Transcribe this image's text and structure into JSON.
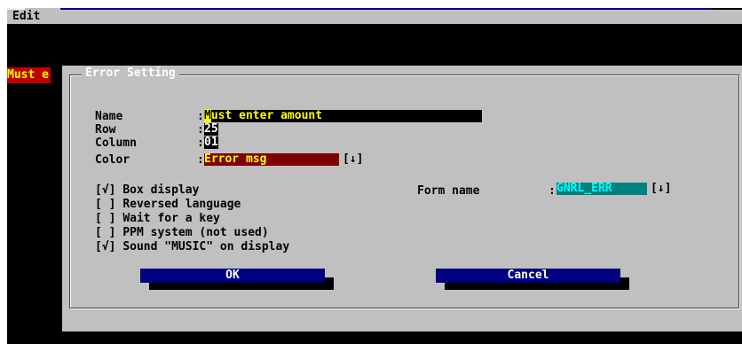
{
  "menu": {
    "edit": "Edit"
  },
  "background_message": "Must e",
  "dialog": {
    "title": "Error Setting",
    "fields": {
      "name_label": "Name",
      "name_first": "M",
      "name_rest": "ust enter amount",
      "row_label": "Row",
      "row_value": "25",
      "column_label": "Column",
      "column_value": "01",
      "color_label": "Color",
      "color_value": "Error msg",
      "color_dropdown": "[↓]",
      "colon": ":"
    },
    "checkboxes": [
      {
        "mark": "[√]",
        "label": "Box display",
        "checked": true
      },
      {
        "mark": "[ ]",
        "label": "Reversed language",
        "checked": false
      },
      {
        "mark": "[ ]",
        "label": "Wait for a key",
        "checked": false
      },
      {
        "mark": "[ ]",
        "label": "PPM system (not used)",
        "checked": false
      },
      {
        "mark": "[√]",
        "label": "Sound \"MUSIC\" on display",
        "checked": true
      }
    ],
    "form_name_label": "Form name",
    "form_name_value": "GNRL_ERR",
    "form_name_dropdown": "[↓]",
    "ok_label": "OK",
    "cancel_label": "Cancel"
  },
  "colors": {
    "dialog_bg": "#c0c0c0",
    "field_name_bg": "#000000",
    "field_text": "#ffff00",
    "color_field_bg": "#800000",
    "form_field_bg": "#008080",
    "button_bg": "#000080"
  }
}
